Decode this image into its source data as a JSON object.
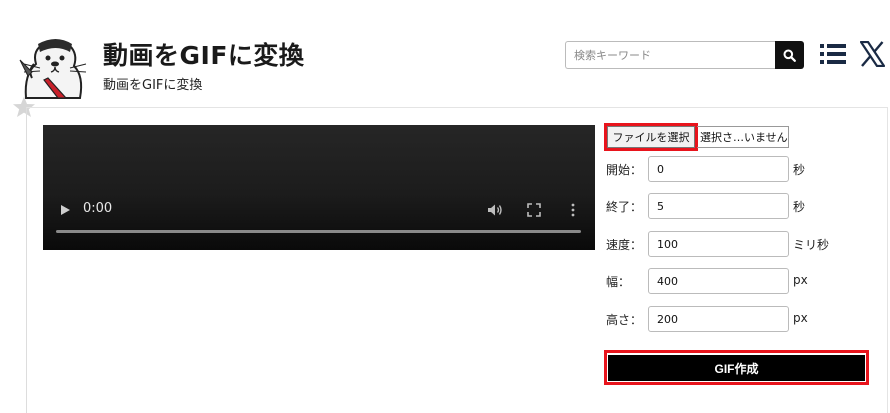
{
  "header": {
    "title": "動画をGIFに変換",
    "subtitle": "動画をGIFに変換",
    "search_placeholder": "検索キーワード"
  },
  "video": {
    "time": "0:00"
  },
  "form": {
    "file_button": "ファイルを選択",
    "file_status": "選択さ…いません",
    "rows": [
      {
        "label": "開始：",
        "value": "0",
        "unit": "秒"
      },
      {
        "label": "終了：",
        "value": "5",
        "unit": "秒"
      },
      {
        "label": "速度：",
        "value": "100",
        "unit": "ミリ秒"
      },
      {
        "label": "幅：",
        "value": "400",
        "unit": "px"
      },
      {
        "label": "高さ：",
        "value": "200",
        "unit": "px"
      }
    ],
    "submit_label": "GIF作成"
  },
  "colors": {
    "highlight": "#e8141c",
    "button_bg": "#000000",
    "accent_dark": "#1a2a44"
  },
  "icons": [
    "logo-otter-icon",
    "search-icon",
    "menu-icon",
    "x-logo-icon",
    "star-icon",
    "play-icon",
    "volume-icon",
    "fullscreen-icon",
    "more-options-icon"
  ]
}
